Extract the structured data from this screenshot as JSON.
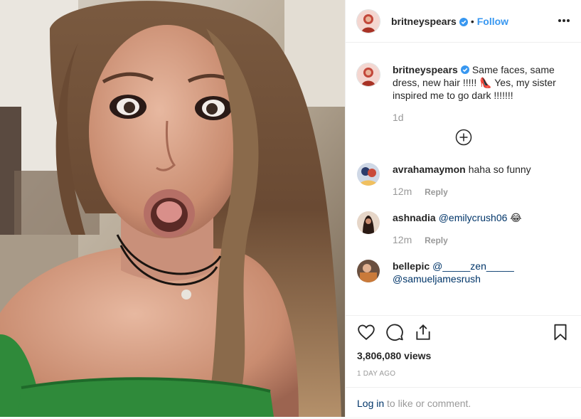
{
  "header": {
    "username": "britneyspears",
    "dot": "•",
    "follow_label": "Follow"
  },
  "caption": {
    "username": "britneyspears",
    "text": "Same faces, same dress, new hair !!!!! 👠 Yes, my sister inspired me to go dark !!!!!!!",
    "time": "1d"
  },
  "comments": [
    {
      "username": "avrahamaymon",
      "text": "haha so funny",
      "time": "12m",
      "reply_label": "Reply"
    },
    {
      "username": "ashnadia",
      "mention": "@emilycrush06",
      "emoji": "😂",
      "time": "12m",
      "reply_label": "Reply"
    },
    {
      "username": "bellepic",
      "mention1": "@_____zen_____",
      "mention2": "@samueljamesrush"
    }
  ],
  "stats": {
    "views": "3,806,080 views",
    "age": "1 DAY AGO"
  },
  "login": {
    "link": "Log in",
    "text": " to like or comment."
  },
  "colors": {
    "accent": "#3897f0",
    "verified": "#3897f0",
    "mention": "#003569",
    "muted": "#999999"
  },
  "icons": [
    "verified-badge-icon",
    "more-options-icon",
    "load-more-plus-icon",
    "heart-icon",
    "comment-icon",
    "share-icon",
    "bookmark-icon"
  ]
}
